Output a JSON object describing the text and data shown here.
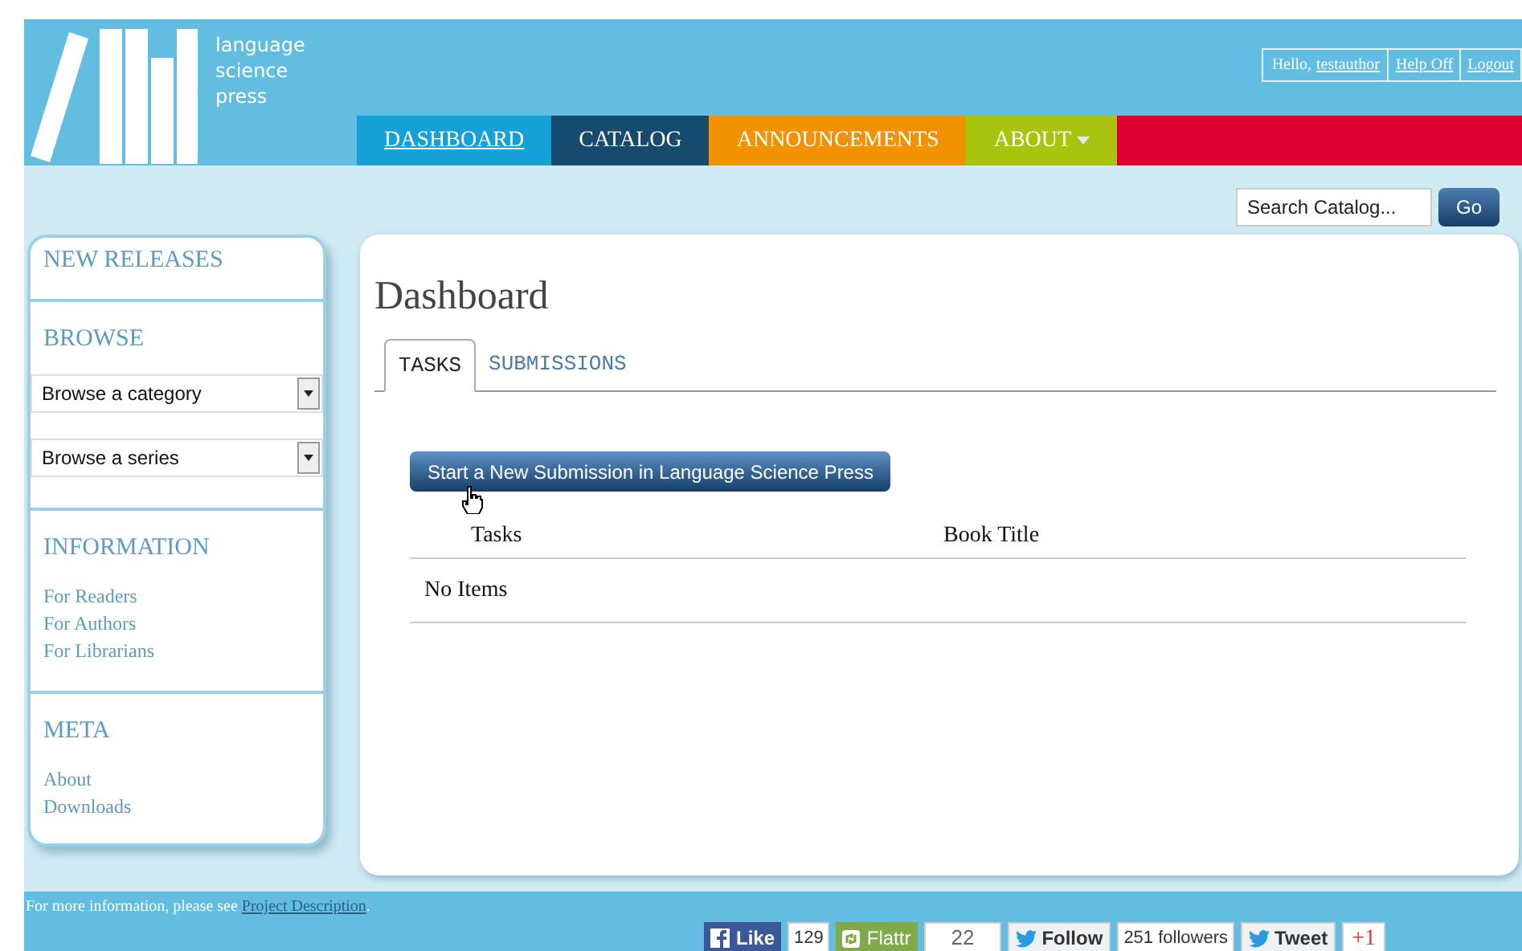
{
  "logo": {
    "lines": [
      "language",
      "science",
      "press"
    ]
  },
  "user_links": {
    "greeting": "Hello,",
    "username": "testauthor",
    "links": [
      "Help Off",
      "Logout"
    ]
  },
  "nav": [
    {
      "label": "DASHBOARD",
      "selected": true,
      "color": "#15a0d6"
    },
    {
      "label": "CATALOG",
      "selected": false,
      "color": "#164a6e"
    },
    {
      "label": "ANNOUNCEMENTS",
      "selected": false,
      "color": "#f39200"
    },
    {
      "label": "ABOUT",
      "selected": false,
      "color": "#a9c40f",
      "dropdown": true
    }
  ],
  "search": {
    "value": "Search Catalog...",
    "button": "Go"
  },
  "sidebar": [
    {
      "title": "NEW RELEASES"
    },
    {
      "title": "BROWSE",
      "selects": [
        "Browse a category",
        "Browse a series"
      ]
    },
    {
      "title": "INFORMATION",
      "links": [
        "For Readers",
        "For Authors",
        "For Librarians"
      ]
    },
    {
      "title": "META",
      "links": [
        "About",
        "Downloads"
      ]
    }
  ],
  "main": {
    "title": "Dashboard",
    "tabs": [
      {
        "label": "TASKS",
        "selected": true
      },
      {
        "label": "SUBMISSIONS",
        "selected": false
      }
    ],
    "button": "Start a New Submission in Language Science Press",
    "table": {
      "columns": [
        "Tasks",
        "Book Title"
      ],
      "empty": "No Items"
    }
  },
  "footer": {
    "text": "For more information, please see",
    "link": "Project Description",
    "after": "."
  },
  "social": [
    {
      "kind": "facebook",
      "label": "Like",
      "count": "129"
    },
    {
      "kind": "flattr",
      "label": "Flattr",
      "count": "22"
    },
    {
      "kind": "twitter",
      "label": "Follow",
      "count": "251 followers"
    },
    {
      "kind": "tweet",
      "label": "Tweet"
    },
    {
      "kind": "gplus",
      "label": "+1"
    }
  ]
}
